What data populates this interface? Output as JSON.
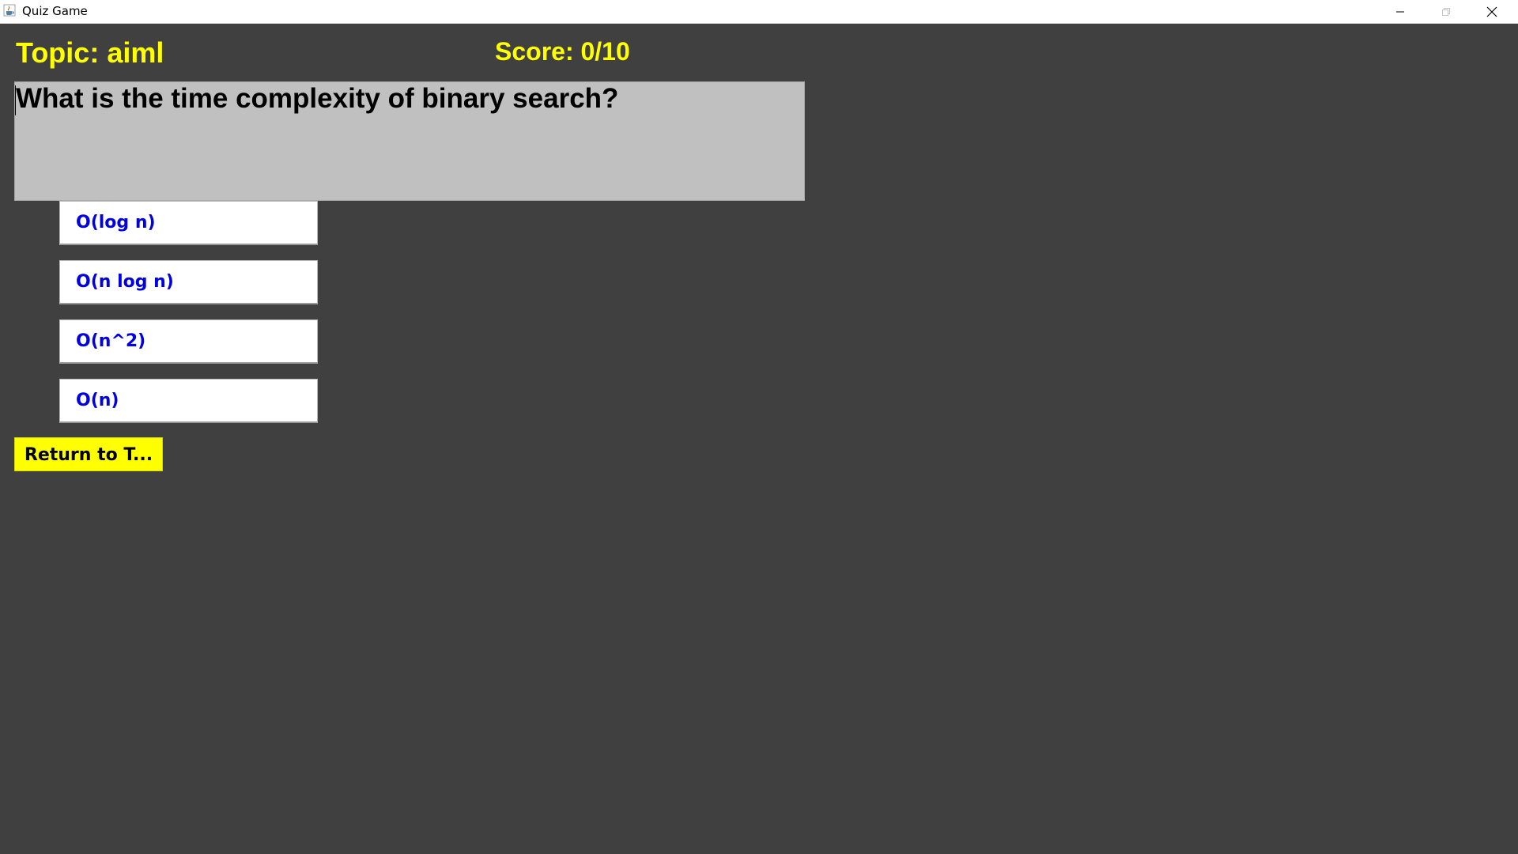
{
  "window": {
    "title": "Quiz Game"
  },
  "header": {
    "topic": "Topic: aiml",
    "score": "Score: 0/10"
  },
  "question": {
    "text": "What is the time complexity of binary search?"
  },
  "options": [
    {
      "label": "O(log n)"
    },
    {
      "label": "O(n log n)"
    },
    {
      "label": "O(n^2)"
    },
    {
      "label": "O(n)"
    }
  ],
  "actions": {
    "return_label": "Return to T..."
  },
  "colors": {
    "background": "#404040",
    "accent_yellow": "#ffff00",
    "option_text": "#0000e0",
    "question_bg": "#c0c0c0"
  },
  "icons": {
    "app": "java-cup-icon",
    "minimize": "minimize-icon",
    "maximize": "maximize-icon",
    "close": "close-icon"
  }
}
